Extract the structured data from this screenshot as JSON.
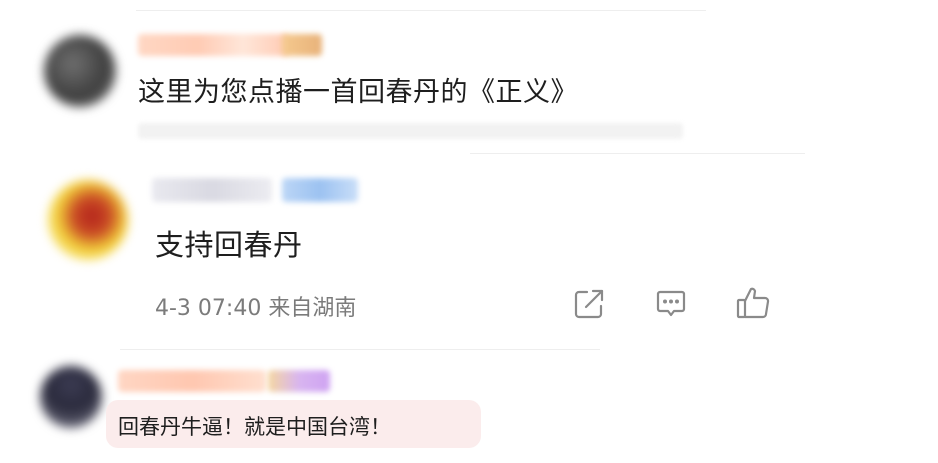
{
  "comments": [
    {
      "text": "这里为您点播一首回春丹的《正义》"
    },
    {
      "text": "支持回春丹",
      "meta": "4-3 07:40 来自湖南",
      "actions": {
        "share_icon": "share-icon",
        "comment_icon": "comment-icon",
        "like_icon": "thumbs-up-icon"
      }
    },
    {
      "text": "回春丹牛逼！就是中国台湾！"
    }
  ],
  "colors": {
    "text": "#1e1e1e",
    "meta": "#7b7b7b",
    "icon": "#8a8a8a",
    "reply_bubble": "#fbecec"
  }
}
